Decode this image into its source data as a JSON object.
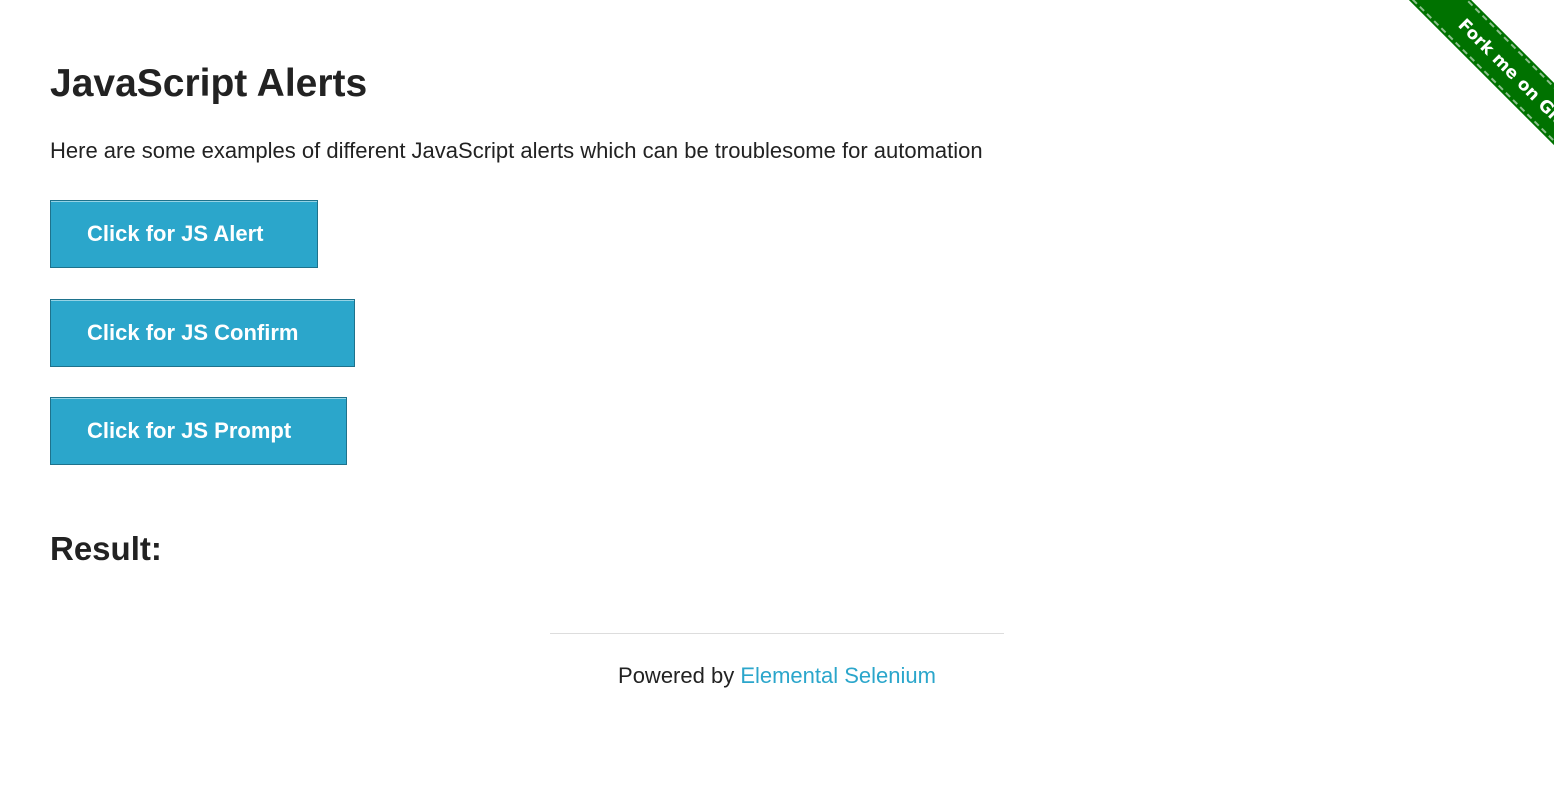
{
  "page": {
    "title": "JavaScript Alerts",
    "description": "Here are some examples of different JavaScript alerts which can be troublesome for automation"
  },
  "buttons": {
    "alert_label": "Click for JS Alert",
    "confirm_label": "Click for JS Confirm",
    "prompt_label": "Click for JS Prompt"
  },
  "result": {
    "heading": "Result:",
    "text": ""
  },
  "footer": {
    "prefix": "Powered by ",
    "link_text": "Elemental Selenium"
  },
  "ribbon": {
    "text": "Fork me on GitHub"
  },
  "colors": {
    "button_bg": "#2ba6cb",
    "link": "#2ba6cb",
    "ribbon": "#007200"
  }
}
